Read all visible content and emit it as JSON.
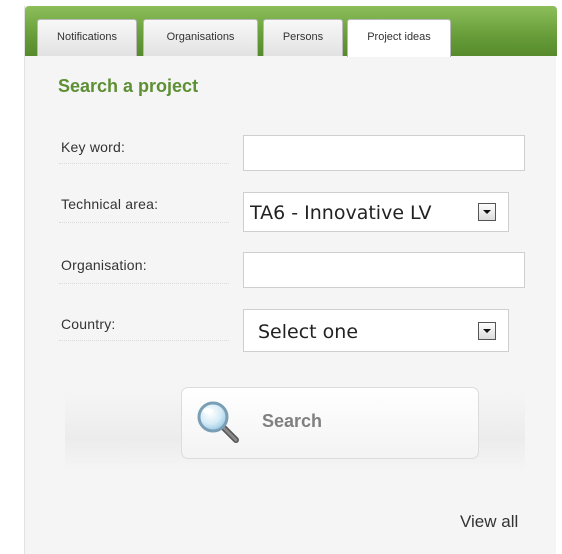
{
  "tabs": {
    "notifications": "Notifications",
    "organisations": "Organisations",
    "persons": "Persons",
    "project_ideas": "Project ideas"
  },
  "active_tab": "Project ideas",
  "section_title": "Search a project",
  "form": {
    "keyword_label": "Key word:",
    "keyword_value": "",
    "technical_area_label": "Technical area:",
    "technical_area_value": "TA6 - Innovative LV",
    "organisation_label": "Organisation:",
    "organisation_value": "",
    "country_label": "Country:",
    "country_value": "Select one"
  },
  "search_label": "Search",
  "view_all_label": "View all",
  "colors": {
    "accent_green": "#6a9f3c",
    "title_green": "#5d8f33"
  },
  "icons": {
    "search": "magnifier-icon",
    "dropdown": "chevron-down-icon"
  }
}
